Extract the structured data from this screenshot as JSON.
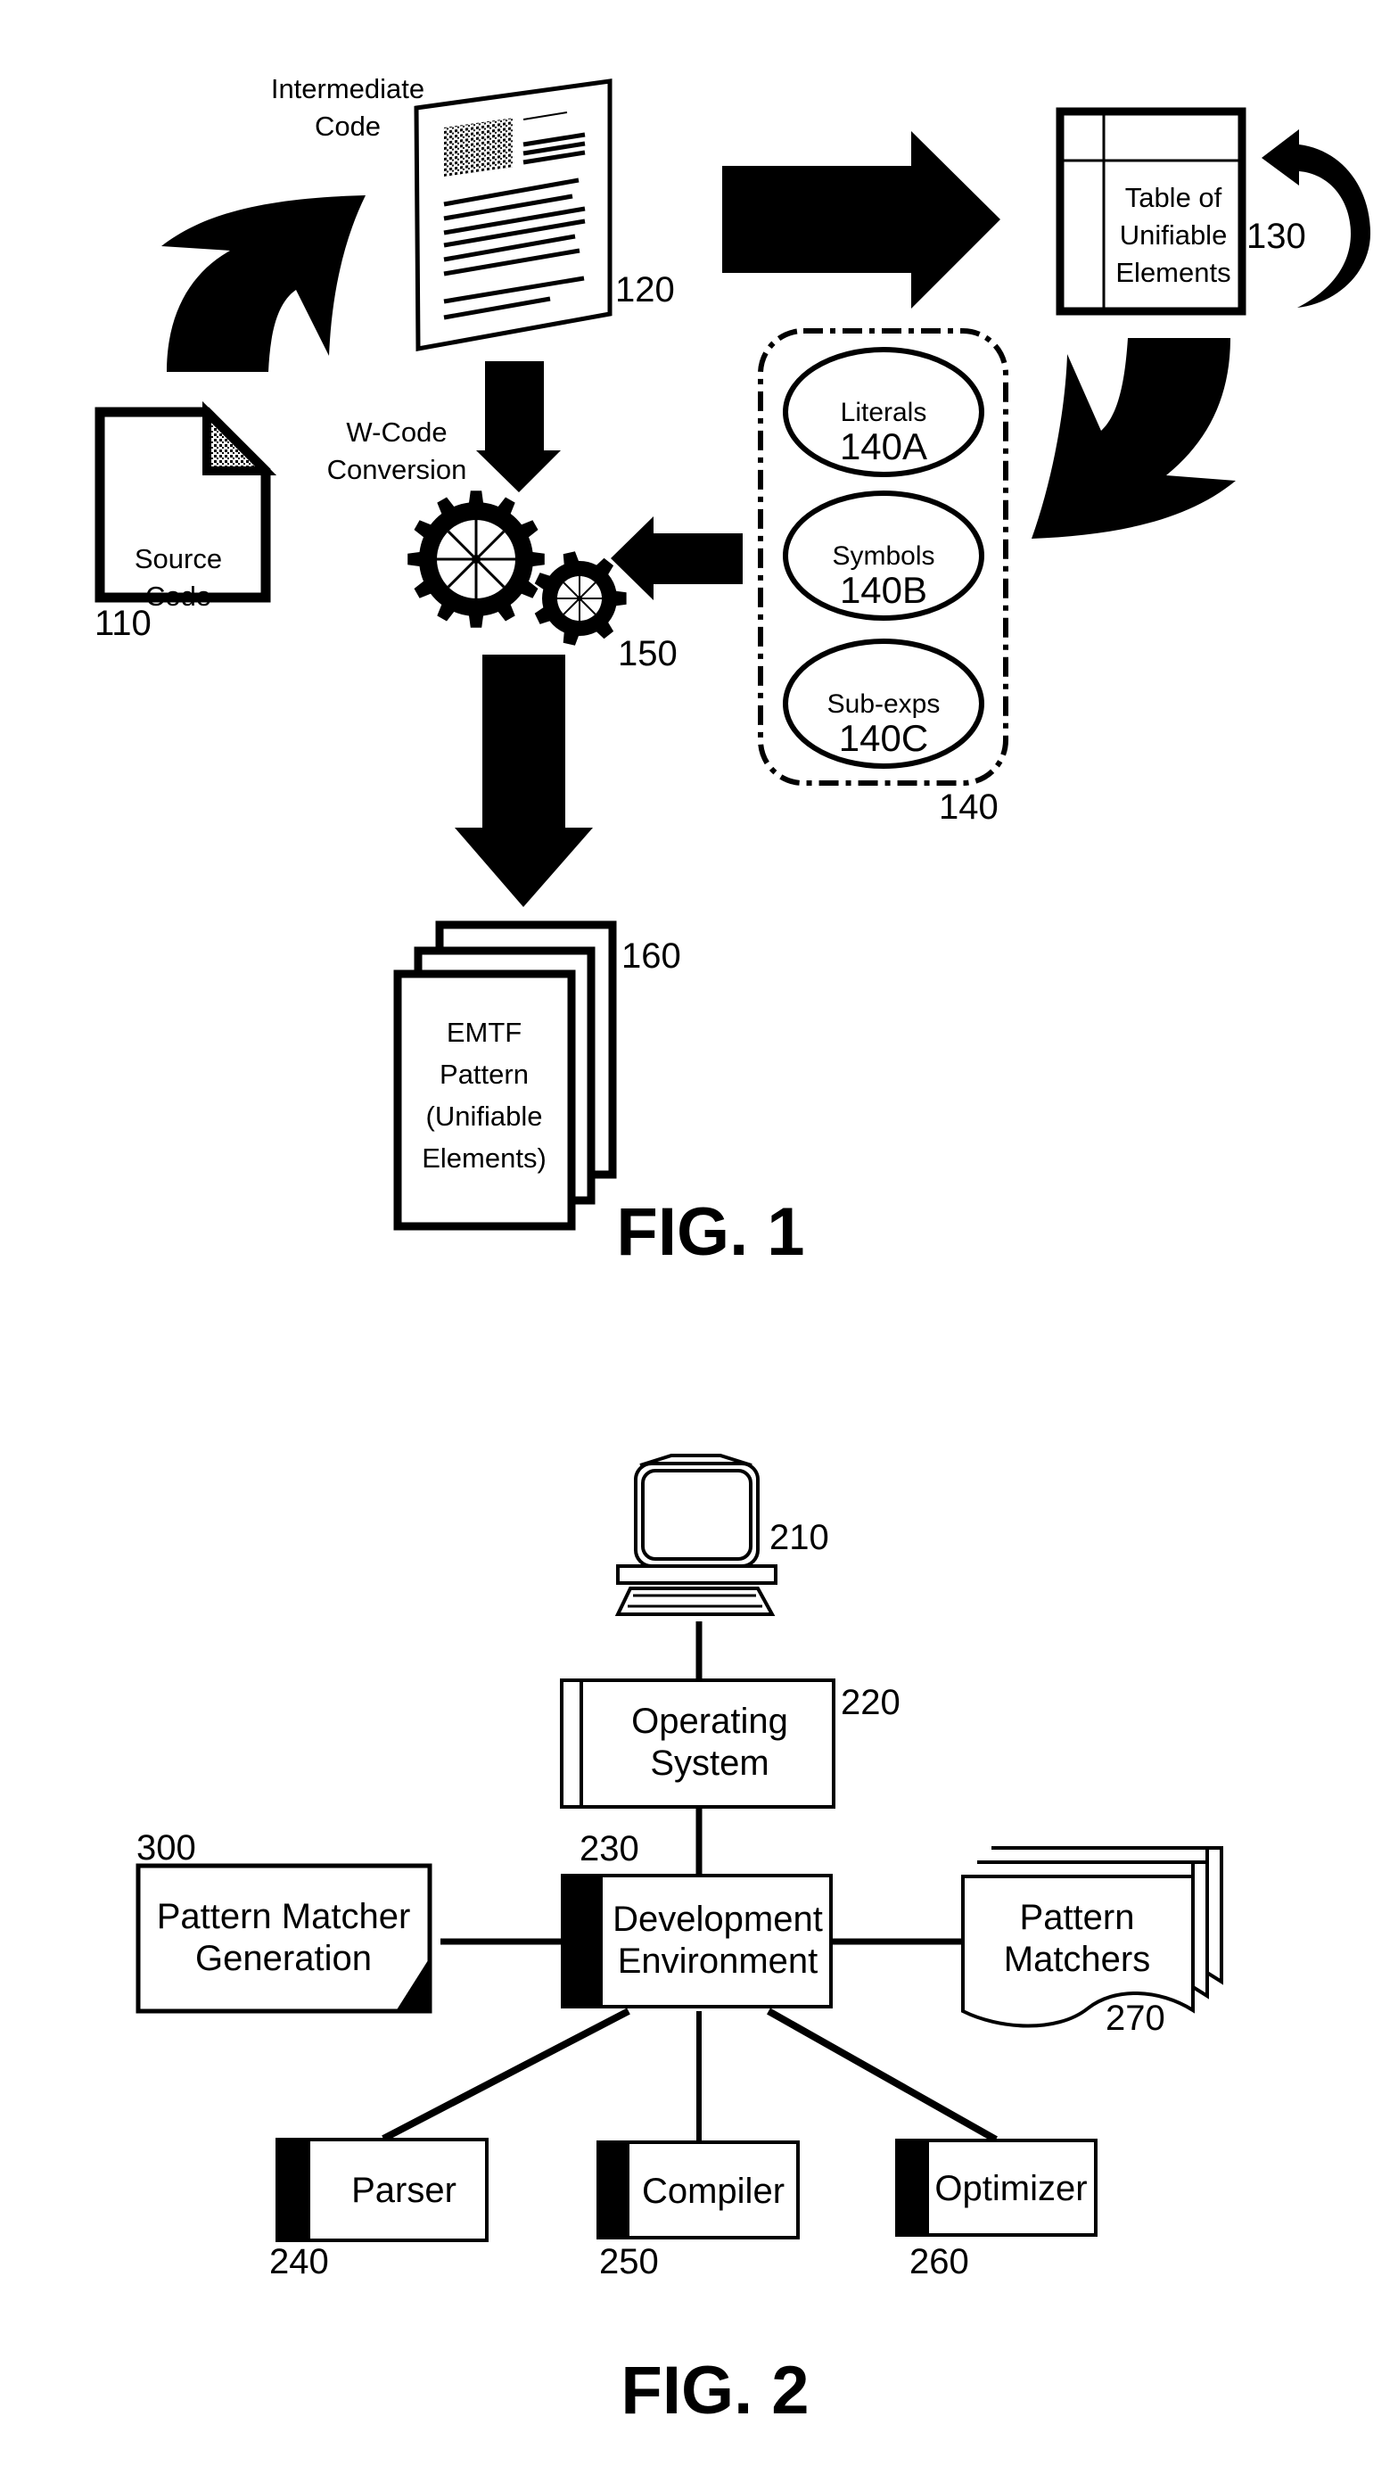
{
  "colors": {
    "ink": "#000000",
    "paper": "#ffffff"
  },
  "fig1": {
    "caption": "FIG. 1",
    "source_code": {
      "line1": "Source",
      "line2": "Code",
      "ref": "110"
    },
    "intermediate_code": {
      "line1": "Intermediate",
      "line2": "Code",
      "ref": "120"
    },
    "table": {
      "line1": "Table of",
      "line2": "Unifiable",
      "line3": "Elements",
      "ref": "130"
    },
    "group": {
      "ref": "140",
      "items": [
        {
          "label": "Literals",
          "ref": "140A"
        },
        {
          "label": "Symbols",
          "ref": "140B"
        },
        {
          "label": "Sub-exps",
          "ref": "140C"
        }
      ]
    },
    "conversion": {
      "line1": "W-Code",
      "line2": "Conversion",
      "ref": "150"
    },
    "output": {
      "line1": "EMTF",
      "line2": "Pattern",
      "line3": "(Unifiable",
      "line4": "Elements)",
      "ref": "160"
    }
  },
  "fig2": {
    "caption": "FIG. 2",
    "computer": {
      "ref": "210"
    },
    "os": {
      "line1": "Operating",
      "line2": "System",
      "ref": "220"
    },
    "dev_env": {
      "line1": "Development",
      "line2": "Environment",
      "ref": "230"
    },
    "pmg": {
      "line1": "Pattern Matcher",
      "line2": "Generation",
      "ref": "300"
    },
    "matchers": {
      "line1": "Pattern",
      "line2": "Matchers",
      "ref": "270"
    },
    "parser": {
      "label": "Parser",
      "ref": "240"
    },
    "compiler": {
      "label": "Compiler",
      "ref": "250"
    },
    "optimizer": {
      "label": "Optimizer",
      "ref": "260"
    }
  }
}
